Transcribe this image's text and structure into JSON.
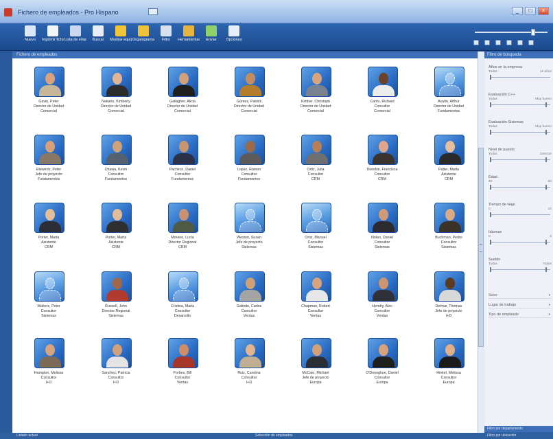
{
  "window": {
    "title": "Fichero de empleados - Pro Hispano",
    "buttons": {
      "minimize": "_",
      "maximize": "□",
      "close": "×"
    }
  },
  "toolbar": {
    "items": [
      {
        "label": "Nuevo",
        "icon": "new-user-icon",
        "color": "#dbe8f8"
      },
      {
        "label": "Imprimir ficha",
        "icon": "document-icon",
        "color": "#f2f6fb"
      },
      {
        "label": "Lista de empleados",
        "icon": "print-icon",
        "color": "#c9d8ee"
      },
      {
        "label": "Buscar",
        "icon": "search-document-icon",
        "color": "#e8eef7"
      },
      {
        "label": "Mostrar equipo",
        "icon": "team-icon",
        "color": "#f1c338"
      },
      {
        "label": "Organigrama",
        "icon": "org-chart-icon",
        "color": "#f0c23a"
      },
      {
        "label": "Filtro",
        "icon": "filter-icon",
        "color": "#d8e2ef"
      },
      {
        "label": "Herramientas",
        "icon": "tools-icon",
        "color": "#e6b440"
      },
      {
        "label": "Enviar",
        "icon": "send-icon",
        "color": "#8fd06a"
      },
      {
        "label": "Opciones",
        "icon": "arrow-icon",
        "color": "#e6eef8"
      }
    ]
  },
  "main": {
    "header": "Fichero de empleados"
  },
  "employees": [
    {
      "name": "Gavin, Peter",
      "role": "Director de Unidad",
      "dept": "Comercial",
      "photo": true,
      "skin": "#d9a27c",
      "shirt": "#c7b69a"
    },
    {
      "name": "Nakano, Kimberly",
      "role": "Director de Unidad",
      "dept": "Comercial",
      "photo": true,
      "skin": "#e3b492",
      "shirt": "#2c2c2c"
    },
    {
      "name": "Gallagher, Alicia",
      "role": "Director de Unidad",
      "dept": "Comercial",
      "photo": true,
      "skin": "#d4a07c",
      "shirt": "#1e1e1e"
    },
    {
      "name": "Gomez, Patrick",
      "role": "Director de Unidad",
      "dept": "Comercial",
      "photo": true,
      "skin": "#c48c60",
      "shirt": "#b47d2c"
    },
    {
      "name": "Kimber, Christoph",
      "role": "Director de Unidad",
      "dept": "Comercial",
      "photo": true,
      "skin": "#d6a580",
      "shirt": "#7a8290"
    },
    {
      "name": "Cantu, Richard",
      "role": "Consultor",
      "dept": "Comercial",
      "photo": true,
      "skin": "#6b4329",
      "shirt": "#ececec"
    },
    {
      "name": "Austin, Arthur",
      "role": "Director de Unidad",
      "dept": "Fundamentos",
      "photo": false
    },
    {
      "name": "Riewerts, Peter",
      "role": "Jefe de proyecto",
      "dept": "Fundamentos",
      "photo": true,
      "skin": "#d8a07a",
      "shirt": "#8a7866"
    },
    {
      "name": "Ozawa, Kevin",
      "role": "Consultor",
      "dept": "Fundamentos",
      "photo": true,
      "skin": "#d0a27a",
      "shirt": "#556070"
    },
    {
      "name": "Pacheco, Daniel",
      "role": "Consultor",
      "dept": "Fundamentos",
      "photo": true,
      "skin": "#c99470",
      "shirt": "#2b3148"
    },
    {
      "name": "Lopez, Ramon",
      "role": "Consultor",
      "dept": "Fundamentos",
      "photo": true,
      "skin": "#9b6a48",
      "shirt": "#5c5a5a"
    },
    {
      "name": "Ortiz, Julia",
      "role": "Consultor",
      "dept": "CRM",
      "photo": true,
      "skin": "#b88058",
      "shirt": "#6f6f6f"
    },
    {
      "name": "Dworkin, Francisca",
      "role": "Consultor",
      "dept": "CRM",
      "photo": true,
      "skin": "#e0a58a",
      "shirt": "#3a3330"
    },
    {
      "name": "Palter, Marta",
      "role": "Asistente",
      "dept": "CRM",
      "photo": true,
      "skin": "#e6c09c",
      "shirt": "#2a2a2a"
    },
    {
      "name": "Porter, Marta",
      "role": "Asistente",
      "dept": "CRM",
      "photo": true,
      "skin": "#e3bc98",
      "shirt": "#2c2c34"
    },
    {
      "name": "Porter, Marta",
      "role": "Asistente",
      "dept": "CRM",
      "photo": true,
      "skin": "#e3bc98",
      "shirt": "#2f2f2f"
    },
    {
      "name": "Moreno, Lucia",
      "role": "Director Regional",
      "dept": "CRM",
      "photo": true,
      "skin": "#c89270",
      "shirt": "#4f5a44"
    },
    {
      "name": "Weston, Susan",
      "role": "Jefe de proyecto",
      "dept": "Sistemas",
      "photo": false
    },
    {
      "name": "Ortiz, Manuel",
      "role": "Consultor",
      "dept": "Sistemas",
      "photo": false
    },
    {
      "name": "Nolan, Daniel",
      "role": "Consultor",
      "dept": "Sistemas",
      "photo": true,
      "skin": "#cf9a76",
      "shirt": "#2b2b30"
    },
    {
      "name": "Buchman, Pedro",
      "role": "Consultor",
      "dept": "Sistemas",
      "photo": true,
      "skin": "#d9aa84",
      "shirt": "#3b3328"
    },
    {
      "name": "Walters, Peter",
      "role": "Consultor",
      "dept": "Sistemas",
      "photo": false
    },
    {
      "name": "Russell, John",
      "role": "Director Regional",
      "dept": "Sistemas",
      "photo": true,
      "skin": "#a06848",
      "shirt": "#b23a2e"
    },
    {
      "name": "Cristina, Maria",
      "role": "Consultor",
      "dept": "Desarrollo",
      "photo": false
    },
    {
      "name": "Galindo, Carlos",
      "role": "Consultor",
      "dept": "Ventas",
      "photo": true,
      "skin": "#cf9f78",
      "shirt": "#a4a4a4"
    },
    {
      "name": "Chapman, Robert",
      "role": "Consultor",
      "dept": "Ventas",
      "photo": true,
      "skin": "#d6a47e",
      "shirt": "#e8e8e8"
    },
    {
      "name": "Hendry, Alec",
      "role": "Consultor",
      "dept": "Ventas",
      "photo": true,
      "skin": "#cc9470",
      "shirt": "#30303a"
    },
    {
      "name": "Delmar, Thomas",
      "role": "Jefe de proyecto",
      "dept": "I+D",
      "photo": true,
      "skin": "#5d3a22",
      "shirt": "#d8d8d8"
    },
    {
      "name": "Hampton, Melissa",
      "role": "Consultor",
      "dept": "I+D",
      "photo": true,
      "skin": "#d9a37e",
      "shirt": "#7c6a56"
    },
    {
      "name": "Sanchez, Patricia",
      "role": "Consultor",
      "dept": "I+D",
      "photo": true,
      "skin": "#d2a07c",
      "shirt": "#e4e4e4"
    },
    {
      "name": "Forbes, Bill",
      "role": "Consultor",
      "dept": "Ventas",
      "photo": true,
      "skin": "#cf8e68",
      "shirt": "#a8352a"
    },
    {
      "name": "Ruiz, Carolina",
      "role": "Consultor",
      "dept": "I+D",
      "photo": true,
      "skin": "#e2b48e",
      "shirt": "#bfae94"
    },
    {
      "name": "McCain, Michael",
      "role": "Jefe de proyecto",
      "dept": "Europa",
      "photo": true,
      "skin": "#d4a07a",
      "shirt": "#2a2e34"
    },
    {
      "name": "O'Donoghue, Daniel",
      "role": "Consultor",
      "dept": "Europa",
      "photo": true,
      "skin": "#d9a27c",
      "shirt": "#1f1f1f"
    },
    {
      "name": "Hinkel, Melissa",
      "role": "Consultor",
      "dept": "Europa",
      "photo": true,
      "skin": "#e0b08a",
      "shirt": "#1a1a1a"
    }
  ],
  "panel": {
    "header": "Filtro de búsqueda",
    "filters": [
      {
        "title": "Años en la empresa",
        "min": "Todos",
        "max": "15 años",
        "knob": 0.0
      },
      {
        "title": "Evaluación C++",
        "min": "Todas",
        "max": "Muy bueno",
        "knob": 0.97
      },
      {
        "title": "Evaluación Sistemas",
        "min": "Todas",
        "max": "Muy bueno",
        "knob": 0.97
      },
      {
        "title": "Nivel de puesto",
        "min": "Todos",
        "max": "Director",
        "knob": 0.97
      },
      {
        "title": "Edad",
        "min": "20",
        "max": "60",
        "knob": 0.97
      },
      {
        "title": "Tiempo de viaje",
        "min": "0",
        "max": "10",
        "knob": 0.0
      },
      {
        "title": "Idiomas",
        "min": "0",
        "max": "5",
        "knob": 0.97
      },
      {
        "title": "Sueldo",
        "min": "Todos",
        "max": "Todos",
        "knob": 0.97
      }
    ],
    "combos": [
      {
        "label": "Sexo"
      },
      {
        "label": "Lugar de trabajo"
      },
      {
        "label": "Tipo de empleado"
      }
    ],
    "footer1": "Filtro por departamento",
    "footer2": "Filtro por ubicación"
  },
  "status": {
    "left": "Listado actual",
    "middle": "Selección de empleados"
  }
}
